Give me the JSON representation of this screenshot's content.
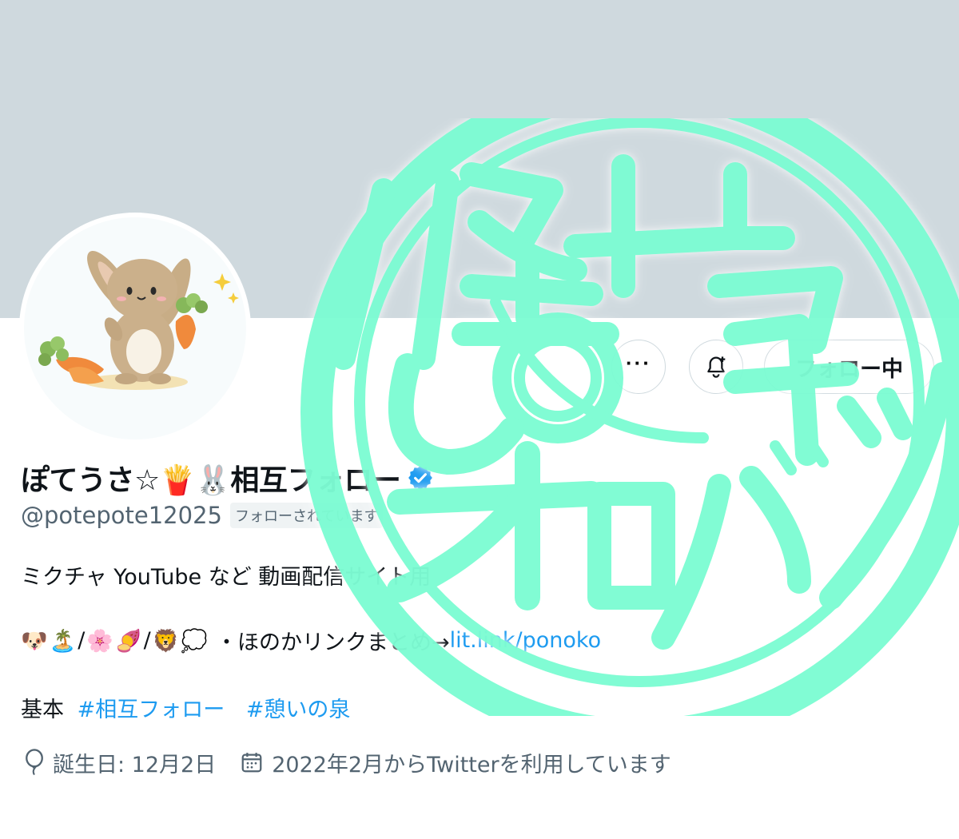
{
  "profile": {
    "display_name": "ぽてうさ☆🍟🐰相互フォロー",
    "handle": "@potepote12025",
    "follows_you_badge": "フォローされています",
    "bio_line1": "ミクチャ YouTube など 動画配信サイト用",
    "bio_line2_emojis": [
      "🐶",
      "🏝️",
      "/",
      "🌸",
      "🍠",
      "/",
      "🦁",
      "💭"
    ],
    "bio_line2_text": "・ほのかリンクまとめ→",
    "bio_line2_link": "lit.link/ponoko",
    "bio_line3_prefix": "基本",
    "hashtags": [
      "#相互フォロー",
      "#憩いの泉"
    ],
    "birthday": "誕生日: 12月2日",
    "joined": "2022年2月からTwitterを利用しています"
  },
  "actions": {
    "more_label": "···",
    "follow_label": "フォロー中"
  },
  "stamp_text": "怪しいオロバ"
}
